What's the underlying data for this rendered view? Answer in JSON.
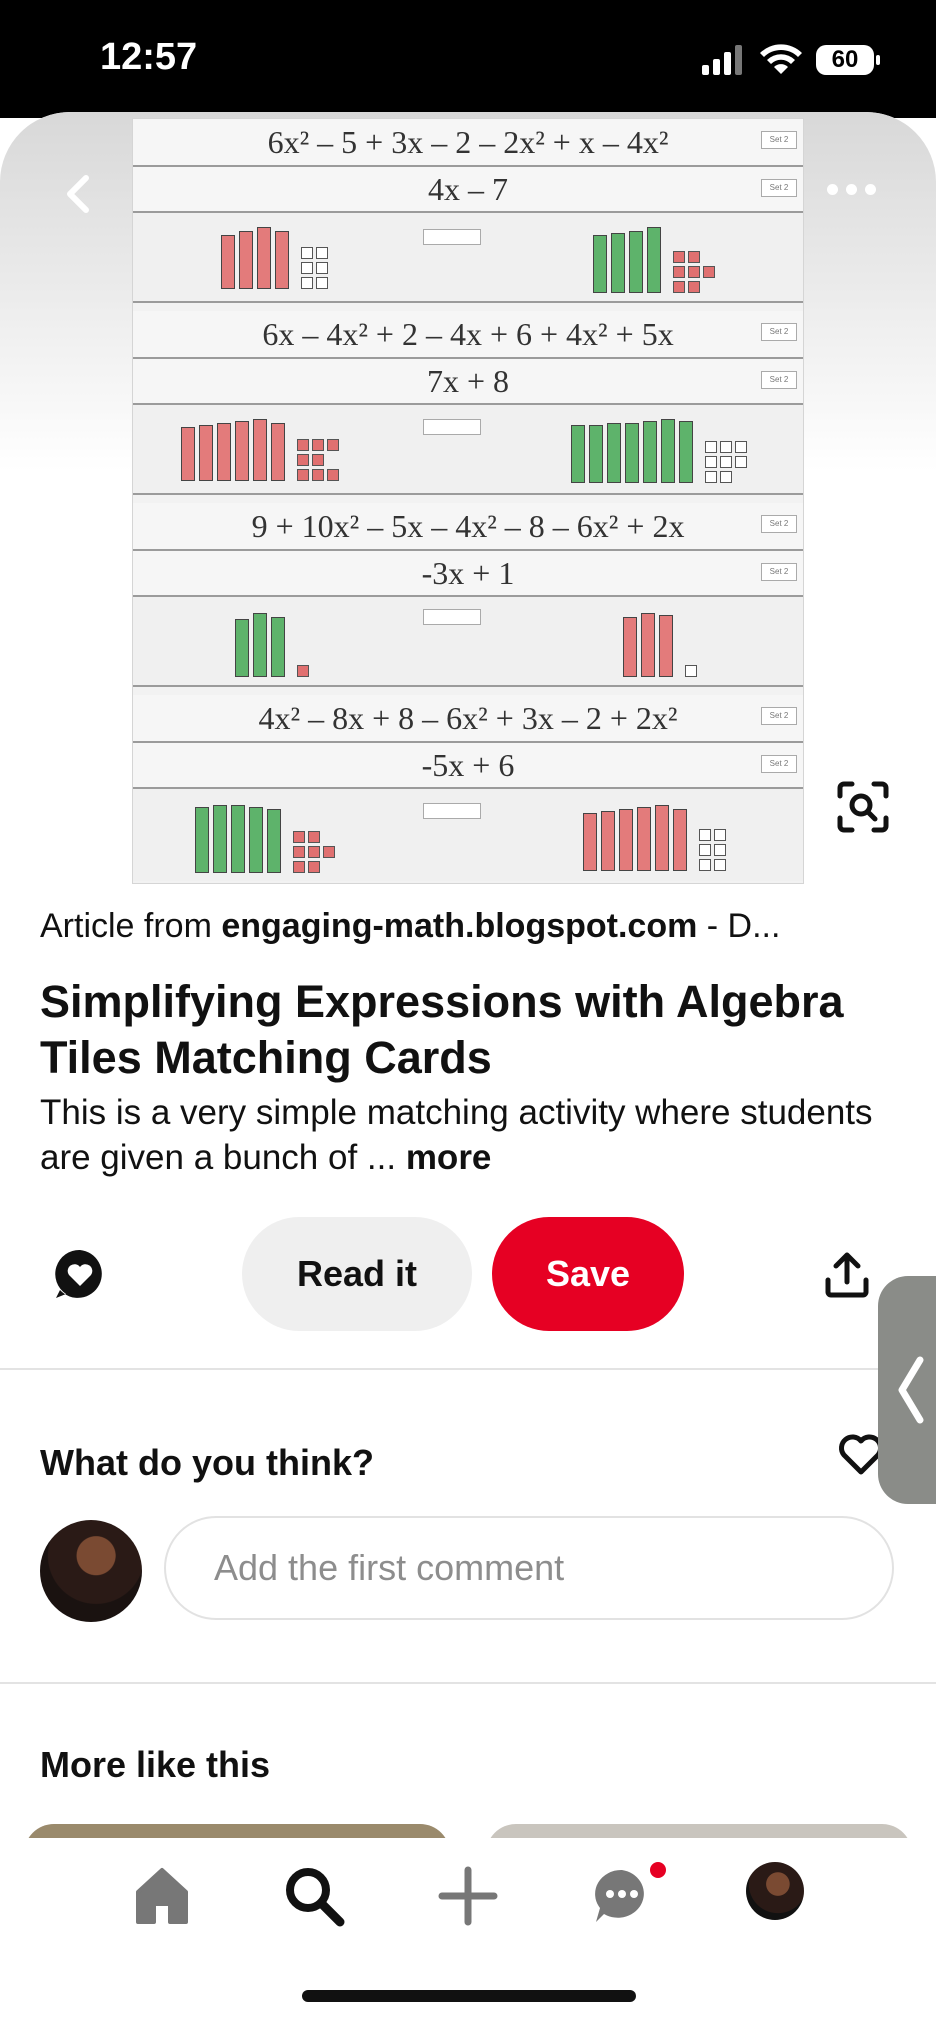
{
  "status_bar": {
    "time": "12:57",
    "battery": "60"
  },
  "pin": {
    "image_rows": [
      {
        "expr": "6x² – 5 + 3x – 2 – 2x² + x – 4x²",
        "simplified": "4x – 7"
      },
      {
        "expr": "6x – 4x² + 2 – 4x + 6 + 4x² + 5x",
        "simplified": "7x + 8"
      },
      {
        "expr": "9 + 10x² – 5x – 4x² – 8 – 6x² + 2x",
        "simplified": "-3x + 1"
      },
      {
        "expr": "4x² – 8x + 8 – 6x² + 3x – 2 + 2x²",
        "simplified": "-5x + 6"
      }
    ],
    "set_label": "Set 2",
    "source_prefix": "Article from ",
    "source_domain": "engaging-math.blogspot.com",
    "source_suffix": " - D...",
    "title": "Simplifying Expressions with Algebra Tiles Matching Cards",
    "description": "This is a very simple matching activity where students are given a bunch of ...",
    "more_label": "more"
  },
  "actions": {
    "read_label": "Read it",
    "save_label": "Save"
  },
  "comments": {
    "heading": "What do you think?",
    "placeholder": "Add the first comment"
  },
  "more_like_this": {
    "heading": "More like this"
  },
  "colors": {
    "save": "#e60023",
    "read_bg": "#efefef"
  }
}
